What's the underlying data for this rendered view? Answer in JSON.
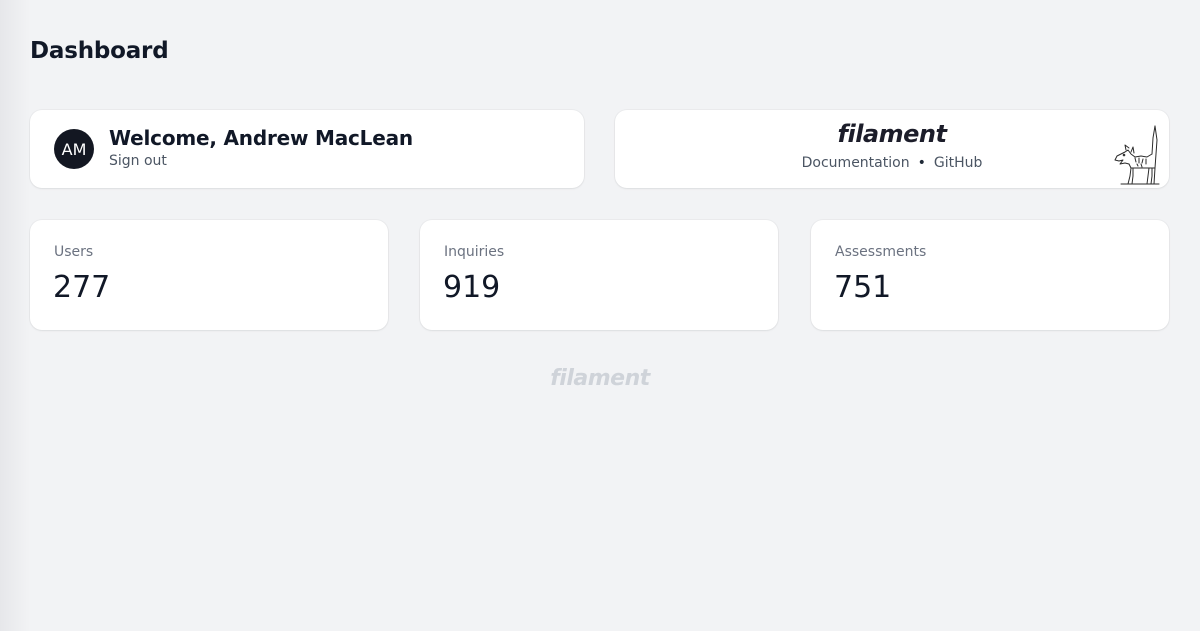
{
  "page": {
    "title": "Dashboard"
  },
  "account": {
    "initials": "AM",
    "welcome": "Welcome, Andrew MacLean",
    "signout_label": "Sign out"
  },
  "brand": {
    "logo_text": "filament",
    "links": [
      "Documentation",
      "GitHub"
    ],
    "separator": "•",
    "illustration_icon": "dog-doodle-icon"
  },
  "stats": [
    {
      "label": "Users",
      "value": "277"
    },
    {
      "label": "Inquiries",
      "value": "919"
    },
    {
      "label": "Assessments",
      "value": "751"
    }
  ],
  "footer": {
    "logo_text": "filament"
  },
  "colors": {
    "background": "#f2f3f5",
    "card": "#ffffff",
    "avatar": "#131722",
    "text_primary": "#111827",
    "text_muted": "#6b7280",
    "footer_logo": "#cfd3d9"
  }
}
